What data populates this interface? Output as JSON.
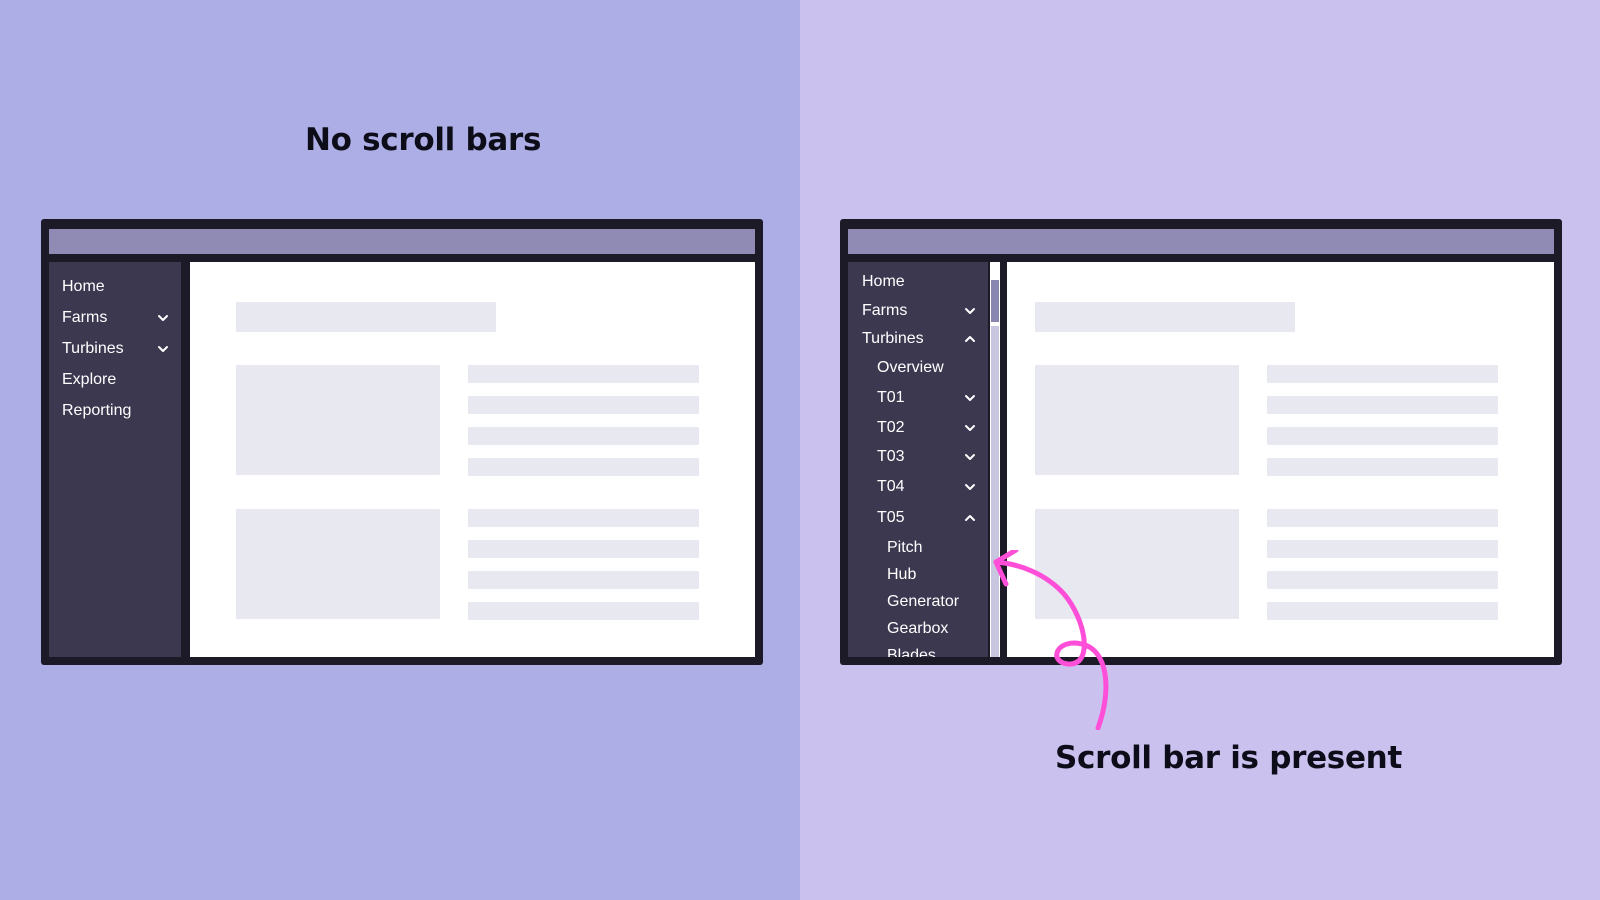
{
  "left_panel": {
    "caption": "No scroll bars",
    "background": "#aeaee6",
    "nav": [
      "Home",
      "Farms",
      "Turbines",
      "Explore",
      "Reporting"
    ]
  },
  "right_panel": {
    "caption": "Scroll bar is present",
    "background": "#cbc1ef",
    "nav": {
      "home": "Home",
      "farms": "Farms",
      "turbines": "Turbines",
      "overview": "Overview",
      "t01": "T01",
      "t02": "T02",
      "t03": "T03",
      "t04": "T04",
      "t05": "T05",
      "pitch": "Pitch",
      "hub": "Hub",
      "generator": "Generator",
      "gearbox": "Gearbox",
      "blades": "Blades"
    }
  },
  "colors": {
    "frame": "#1c1a27",
    "sidebar": "#3b3850",
    "titlebar": "#908bb4",
    "placeholder": "#e8e8f1",
    "annotation_arrow": "#ff4fd8"
  },
  "icons": {
    "expand": "chevron-down-icon",
    "collapse": "chevron-up-icon"
  }
}
